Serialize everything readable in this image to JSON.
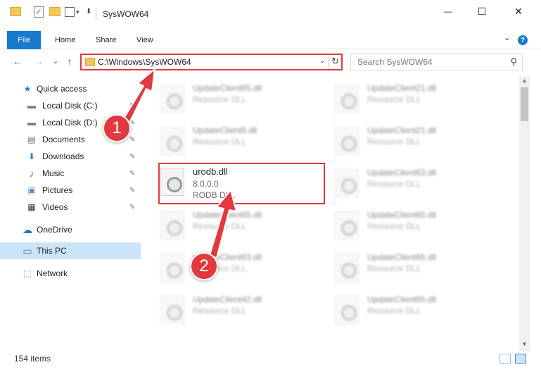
{
  "window": {
    "title": "SysWOW64",
    "minimize_glyph": "—",
    "maximize_glyph": "☐",
    "close_glyph": "✕"
  },
  "ribbon": {
    "file": "File",
    "tabs": [
      "Home",
      "Share",
      "View"
    ],
    "expand_glyph": "⌄",
    "help_glyph": "?"
  },
  "nav_buttons": {
    "back": "←",
    "forward": "→",
    "recent": "⌄",
    "up": "↑"
  },
  "address": {
    "path": "C:\\Windows\\SysWOW64",
    "dropdown_glyph": "⌄",
    "refresh_glyph": "↻"
  },
  "search": {
    "placeholder": "Search SysWOW64",
    "icon_glyph": "⚲"
  },
  "sidebar": {
    "items": [
      {
        "label": "Quick access",
        "icon": "star-icon",
        "glyph": "★"
      },
      {
        "label": "Local Disk (C:)",
        "icon": "drive-icon",
        "glyph": "▬"
      },
      {
        "label": "Local Disk (D:)",
        "icon": "drive-icon",
        "glyph": "▬"
      },
      {
        "label": "Documents",
        "icon": "document-icon",
        "glyph": "▤"
      },
      {
        "label": "Downloads",
        "icon": "download-icon",
        "glyph": "⬇"
      },
      {
        "label": "Music",
        "icon": "music-icon",
        "glyph": "♪"
      },
      {
        "label": "Pictures",
        "icon": "pictures-icon",
        "glyph": "▣"
      },
      {
        "label": "Videos",
        "icon": "video-icon",
        "glyph": "▦"
      },
      {
        "label": "OneDrive",
        "icon": "cloud-icon",
        "glyph": "☁"
      },
      {
        "label": "This PC",
        "icon": "computer-icon",
        "glyph": "▭"
      },
      {
        "label": "Network",
        "icon": "network-icon",
        "glyph": "⬚"
      }
    ],
    "pin_glyph": "✎"
  },
  "files": [
    {
      "name": "UpdateClient65.dll",
      "type": "Resource DLL"
    },
    {
      "name": "UpdateClient21.dll",
      "type": "Resource DLL"
    },
    {
      "name": "UpdateClient5.dll",
      "type": "Resource DLL"
    },
    {
      "name": "UpdateClient21.dll",
      "type": "Resource DLL"
    },
    {
      "name": "urodb.dll",
      "version": "8.0.0.0",
      "type": "RODB DLL"
    },
    {
      "name": "UpdateClient63.dll",
      "type": "Resource DLL"
    },
    {
      "name": "UpdateClient65.dll",
      "type": "Resource DLL"
    },
    {
      "name": "UpdateClient65.dll",
      "type": "Resource DLL"
    },
    {
      "name": "UpdateClient63.dll",
      "type": "Resource DLL"
    },
    {
      "name": "UpdateClient65.dll",
      "type": "Resource DLL"
    },
    {
      "name": "UpdateClient42.dll",
      "type": "Resource DLL"
    },
    {
      "name": "UpdateClient65.dll",
      "type": "Resource DLL"
    }
  ],
  "status": {
    "item_count": "154 items"
  },
  "annotations": {
    "step1": "1",
    "step2": "2",
    "color": "#e0393e"
  },
  "colors": {
    "accent": "#1979ca",
    "selection": "#cce4f7"
  }
}
